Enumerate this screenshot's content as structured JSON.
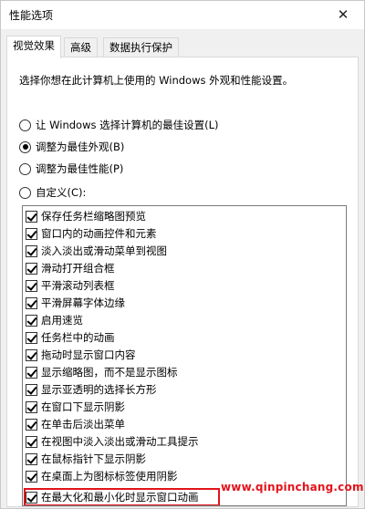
{
  "window": {
    "title": "性能选项"
  },
  "tabs": [
    {
      "label": "视觉效果",
      "active": true
    },
    {
      "label": "高级",
      "active": false
    },
    {
      "label": "数据执行保护",
      "active": false
    }
  ],
  "panel": {
    "description": "选择你想在此计算机上使用的 Windows 外观和性能设置。",
    "radios": [
      {
        "label": "让 Windows 选择计算机的最佳设置(L)",
        "checked": false
      },
      {
        "label": "调整为最佳外观(B)",
        "checked": true
      },
      {
        "label": "调整为最佳性能(P)",
        "checked": false
      },
      {
        "label": "自定义(C):",
        "checked": false
      }
    ],
    "options": [
      {
        "label": "保存任务栏缩略图预览",
        "checked": true
      },
      {
        "label": "窗口内的动画控件和元素",
        "checked": true
      },
      {
        "label": "淡入淡出或滑动菜单到视图",
        "checked": true
      },
      {
        "label": "滑动打开组合框",
        "checked": true
      },
      {
        "label": "平滑滚动列表框",
        "checked": true
      },
      {
        "label": "平滑屏幕字体边缘",
        "checked": true
      },
      {
        "label": "启用速览",
        "checked": true
      },
      {
        "label": "任务栏中的动画",
        "checked": true
      },
      {
        "label": "拖动时显示窗口内容",
        "checked": true
      },
      {
        "label": "显示缩略图，而不是显示图标",
        "checked": true
      },
      {
        "label": "显示亚透明的选择长方形",
        "checked": true
      },
      {
        "label": "在窗口下显示阴影",
        "checked": true
      },
      {
        "label": "在单击后淡出菜单",
        "checked": true
      },
      {
        "label": "在视图中淡入淡出或滑动工具提示",
        "checked": true
      },
      {
        "label": "在鼠标指针下显示阴影",
        "checked": true
      },
      {
        "label": "在桌面上为图标标签使用阴影",
        "checked": true
      },
      {
        "label": "在最大化和最小化时显示窗口动画",
        "checked": true
      }
    ]
  },
  "watermark": {
    "text": "www.qinpinchang.com"
  },
  "colors": {
    "highlight": "#e3131b",
    "watermark": "#e3131b"
  }
}
